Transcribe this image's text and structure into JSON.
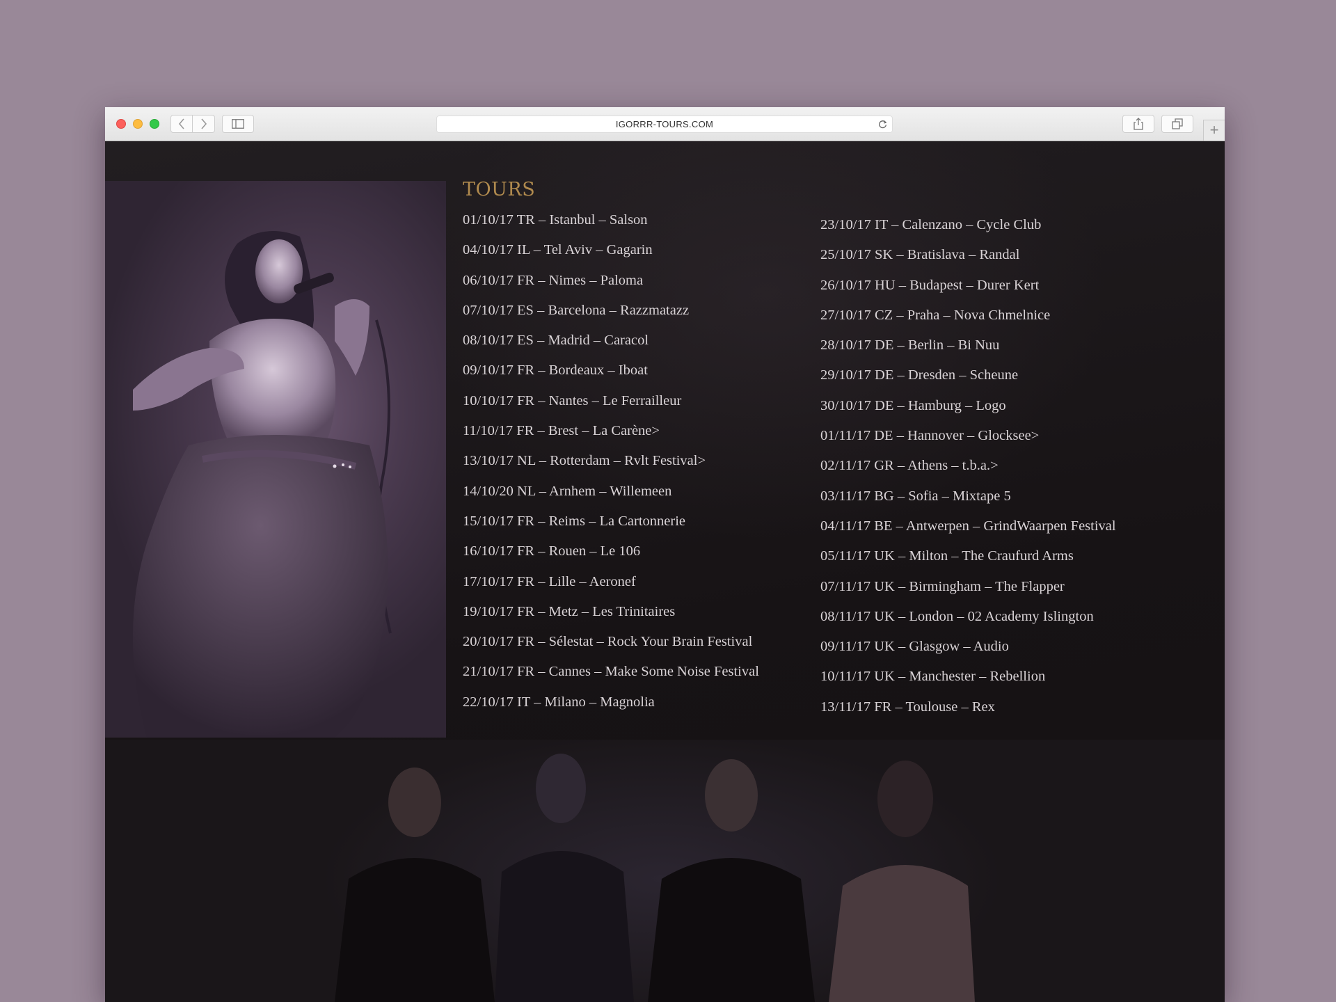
{
  "browser": {
    "url": "IGORRR-TOURS.COM"
  },
  "page": {
    "section_title": "TOURS",
    "tours_left": [
      "01/10/17 TR – Istanbul – Salson",
      "04/10/17 IL – Tel Aviv – Gagarin",
      "06/10/17 FR – Nimes – Paloma",
      "07/10/17 ES – Barcelona – Razzmatazz",
      "08/10/17 ES – Madrid – Caracol",
      "09/10/17 FR – Bordeaux – Iboat",
      "10/10/17 FR – Nantes – Le Ferrailleur",
      "11/10/17 FR – Brest – La Carène>",
      "13/10/17 NL – Rotterdam – Rvlt Festival>",
      "14/10/20 NL – Arnhem – Willemeen",
      "15/10/17 FR – Reims – La Cartonnerie",
      "16/10/17 FR – Rouen – Le 106",
      "17/10/17 FR – Lille – Aeronef",
      "19/10/17 FR – Metz – Les Trinitaires",
      "20/10/17 FR – Sélestat – Rock Your Brain Festival",
      "21/10/17 FR – Cannes – Make Some Noise Festival",
      "22/10/17 IT – Milano – Magnolia"
    ],
    "tours_right": [
      "23/10/17 IT – Calenzano – Cycle Club",
      "25/10/17 SK – Bratislava – Randal",
      "26/10/17 HU – Budapest – Durer Kert",
      "27/10/17 CZ – Praha – Nova Chmelnice",
      "28/10/17 DE – Berlin – Bi Nuu",
      "29/10/17 DE – Dresden – Scheune",
      "30/10/17 DE – Hamburg – Logo",
      "01/11/17 DE – Hannover – Glocksee>",
      "02/11/17 GR – Athens – t.b.a.>",
      "03/11/17 BG – Sofia – Mixtape 5",
      "04/11/17 BE – Antwerpen – GrindWaarpen Festival",
      "05/11/17 UK – Milton – The Craufurd Arms",
      "07/11/17 UK – Birmingham – The Flapper",
      "08/11/17 UK – London – 02 Academy Islington",
      "09/11/17 UK – Glasgow – Audio",
      "10/11/17 UK – Manchester – Rebellion",
      "13/11/17 FR – Toulouse – Rex"
    ]
  },
  "colors": {
    "background": "#998898",
    "page_bg": "#1a1618",
    "title_gold": "#b08a4e",
    "text": "#d9d3d6",
    "photo_tint": "#4a3a4f"
  }
}
